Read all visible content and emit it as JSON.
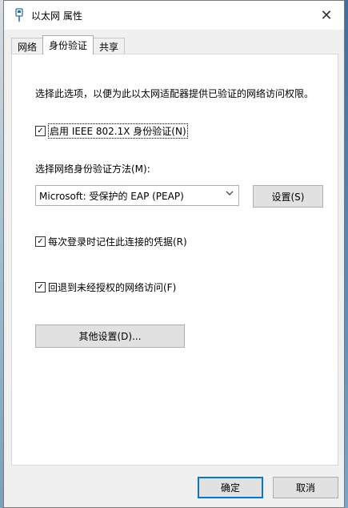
{
  "window": {
    "title": "以太网 属性",
    "close_glyph": "✕",
    "icon": "ethernet-adapter-icon"
  },
  "tabs": [
    {
      "label": "网络",
      "active": false
    },
    {
      "label": "身份验证",
      "active": true
    },
    {
      "label": "共享",
      "active": false
    }
  ],
  "auth": {
    "description": "选择此选项，以便为此以太网适配器提供已验证的网络访问权限。",
    "enable_8021x": {
      "label": "启用 IEEE 802.1X 身份验证(N)",
      "checked": true
    },
    "method_label": "选择网络身份验证方法(M):",
    "method_selected": "Microsoft: 受保护的 EAP (PEAP)",
    "settings_button": "设置(S)",
    "remember_credentials": {
      "label": "每次登录时记住此连接的凭据(R)",
      "checked": true
    },
    "fallback_unauthorized": {
      "label": "回退到未经授权的网络访问(F)",
      "checked": true
    },
    "other_settings_button": "其他设置(D)..."
  },
  "footer": {
    "ok_button": "确定",
    "cancel_button": "取消"
  },
  "colors": {
    "accent": "#0078d7",
    "dialog_bg": "#f0f0f0",
    "panel_bg": "#ffffff"
  }
}
